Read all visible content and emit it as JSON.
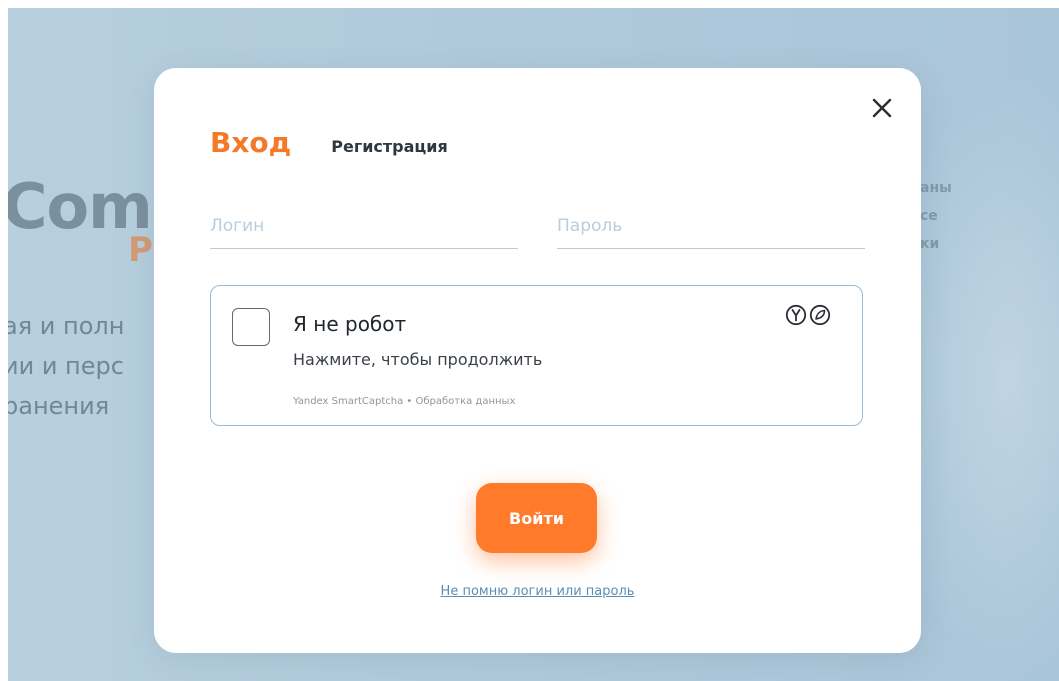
{
  "background": {
    "brand_main": "Comp",
    "brand_sub": "Р",
    "tagline_lines": [
      "ая и полн",
      "ии и перс",
      "ранения"
    ],
    "right_lines": [
      "аны",
      "се",
      "ки"
    ]
  },
  "modal": {
    "tabs": {
      "login": "Вход",
      "register": "Регистрация"
    },
    "fields": {
      "login": {
        "placeholder": "Логин",
        "value": ""
      },
      "password": {
        "placeholder": "Пароль",
        "value": ""
      }
    },
    "captcha": {
      "title": "Я не робот",
      "subtitle": "Нажмите, чтобы продолжить",
      "footer": "Yandex SmartCaptcha • Обработка данных",
      "logo_icon": "yandex-smartcaptcha-logo-icon"
    },
    "submit_label": "Войти",
    "forgot_link": "Не помню логин или пароль",
    "close_icon": "close-icon"
  },
  "colors": {
    "accent": "#f47a2a",
    "button": "#ff7a2a",
    "backdrop": "#b0cadb",
    "link": "#5b8db4"
  }
}
